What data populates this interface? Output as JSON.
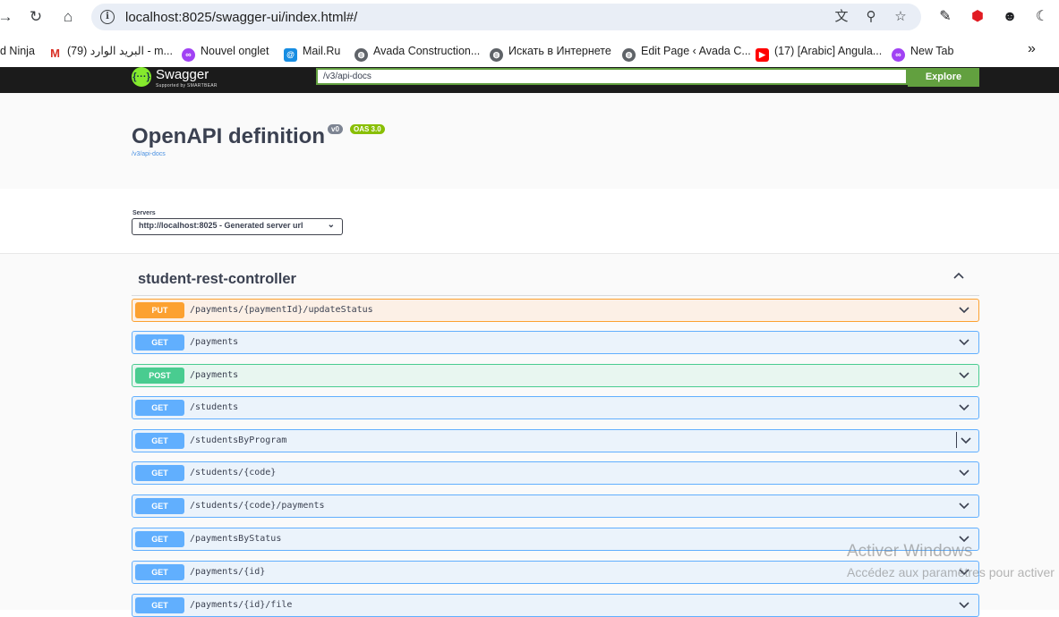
{
  "browser": {
    "url": "localhost:8025/swagger-ui/index.html#/",
    "bookmarks": [
      {
        "label": "d Ninja",
        "icon": "none"
      },
      {
        "label": "البريد الوارد (79) - m...",
        "icon": "gmail-icon"
      },
      {
        "label": "Nouvel onglet",
        "icon": "tab-icon"
      },
      {
        "label": "Mail.Ru",
        "icon": "mailru-icon"
      },
      {
        "label": "Avada Construction...",
        "icon": "globe-icon"
      },
      {
        "label": "Искать в Интернете",
        "icon": "globe-icon"
      },
      {
        "label": "Edit Page ‹ Avada C...",
        "icon": "globe-icon"
      },
      {
        "label": "(17) [Arabic] Angula...",
        "icon": "youtube-icon"
      },
      {
        "label": "New Tab",
        "icon": "tab-icon"
      }
    ],
    "more_bookmarks": "»"
  },
  "swagger": {
    "logo_text": "Swagger",
    "logo_sub": "Supported by SMARTBEAR",
    "spec_url": "/v3/api-docs",
    "explore_label": "Explore"
  },
  "info": {
    "title": "OpenAPI definition",
    "version": "v0",
    "oas": "OAS 3.0",
    "link": "/v3/api-docs"
  },
  "servers": {
    "label": "Servers",
    "selected": "http://localhost:8025 - Generated server url"
  },
  "tag": {
    "name": "student-rest-controller"
  },
  "operations": [
    {
      "method": "PUT",
      "path": "/payments/{paymentId}/updateStatus"
    },
    {
      "method": "GET",
      "path": "/payments"
    },
    {
      "method": "POST",
      "path": "/payments"
    },
    {
      "method": "GET",
      "path": "/students"
    },
    {
      "method": "GET",
      "path": "/studentsByProgram"
    },
    {
      "method": "GET",
      "path": "/students/{code}"
    },
    {
      "method": "GET",
      "path": "/students/{code}/payments"
    },
    {
      "method": "GET",
      "path": "/paymentsByStatus"
    },
    {
      "method": "GET",
      "path": "/payments/{id}"
    },
    {
      "method": "GET",
      "path": "/payments/{id}/file"
    }
  ],
  "watermark": {
    "title": "Activer Windows",
    "subtitle": "Accédez aux paramètres pour activer"
  },
  "colors": {
    "put": "#fca130",
    "get": "#61affe",
    "post": "#49cc90",
    "swagger_green": "#62a03f"
  }
}
